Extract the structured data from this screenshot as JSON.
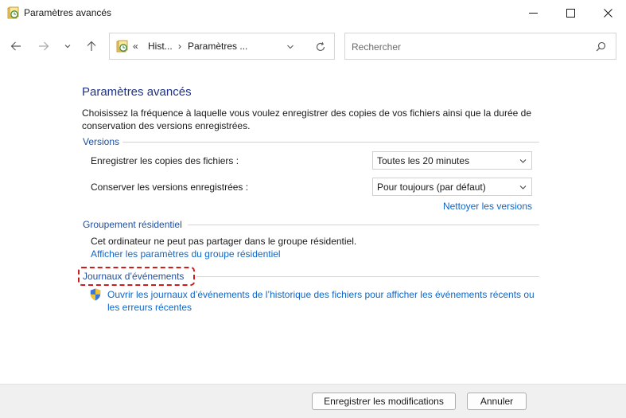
{
  "window": {
    "title": "Paramètres avancés",
    "icon": "file-history-icon"
  },
  "nav": {
    "back_icon": "arrow-left-icon",
    "forward_icon": "arrow-right-icon",
    "recent_icon": "chevron-down-icon",
    "up_icon": "arrow-up-icon"
  },
  "address": {
    "separator": "«",
    "crumbs": [
      "Hist...",
      "Paramètres ..."
    ],
    "arrow": "›"
  },
  "search": {
    "placeholder": "Rechercher"
  },
  "page": {
    "title": "Paramètres avancés",
    "description": "Choisissez la fréquence à laquelle vous voulez enregistrer des copies de vos fichiers ainsi que la durée de conservation des versions enregistrées."
  },
  "versions": {
    "heading": "Versions",
    "save_copies_label": "Enregistrer les copies des fichiers :",
    "save_copies_value": "Toutes les 20 minutes",
    "keep_versions_label": "Conserver les versions enregistrées :",
    "keep_versions_value": "Pour toujours (par défaut)",
    "cleanup_link": "Nettoyer les versions"
  },
  "homegroup": {
    "heading": "Groupement résidentiel",
    "status_text": "Cet ordinateur ne peut pas partager dans le groupe résidentiel.",
    "settings_link": "Afficher les paramètres du groupe résidentiel"
  },
  "events": {
    "heading": "Journaux d’événements",
    "open_link": "Ouvrir les journaux d’événements de l’historique des fichiers pour afficher les événements récents ou les erreurs récentes"
  },
  "footer": {
    "save_label": "Enregistrer les modifications",
    "cancel_label": "Annuler"
  },
  "colors": {
    "title_blue": "#1e3287",
    "section_blue": "#1f4e9e",
    "link_blue": "#1066c9",
    "highlight_red": "#d11b1b"
  }
}
